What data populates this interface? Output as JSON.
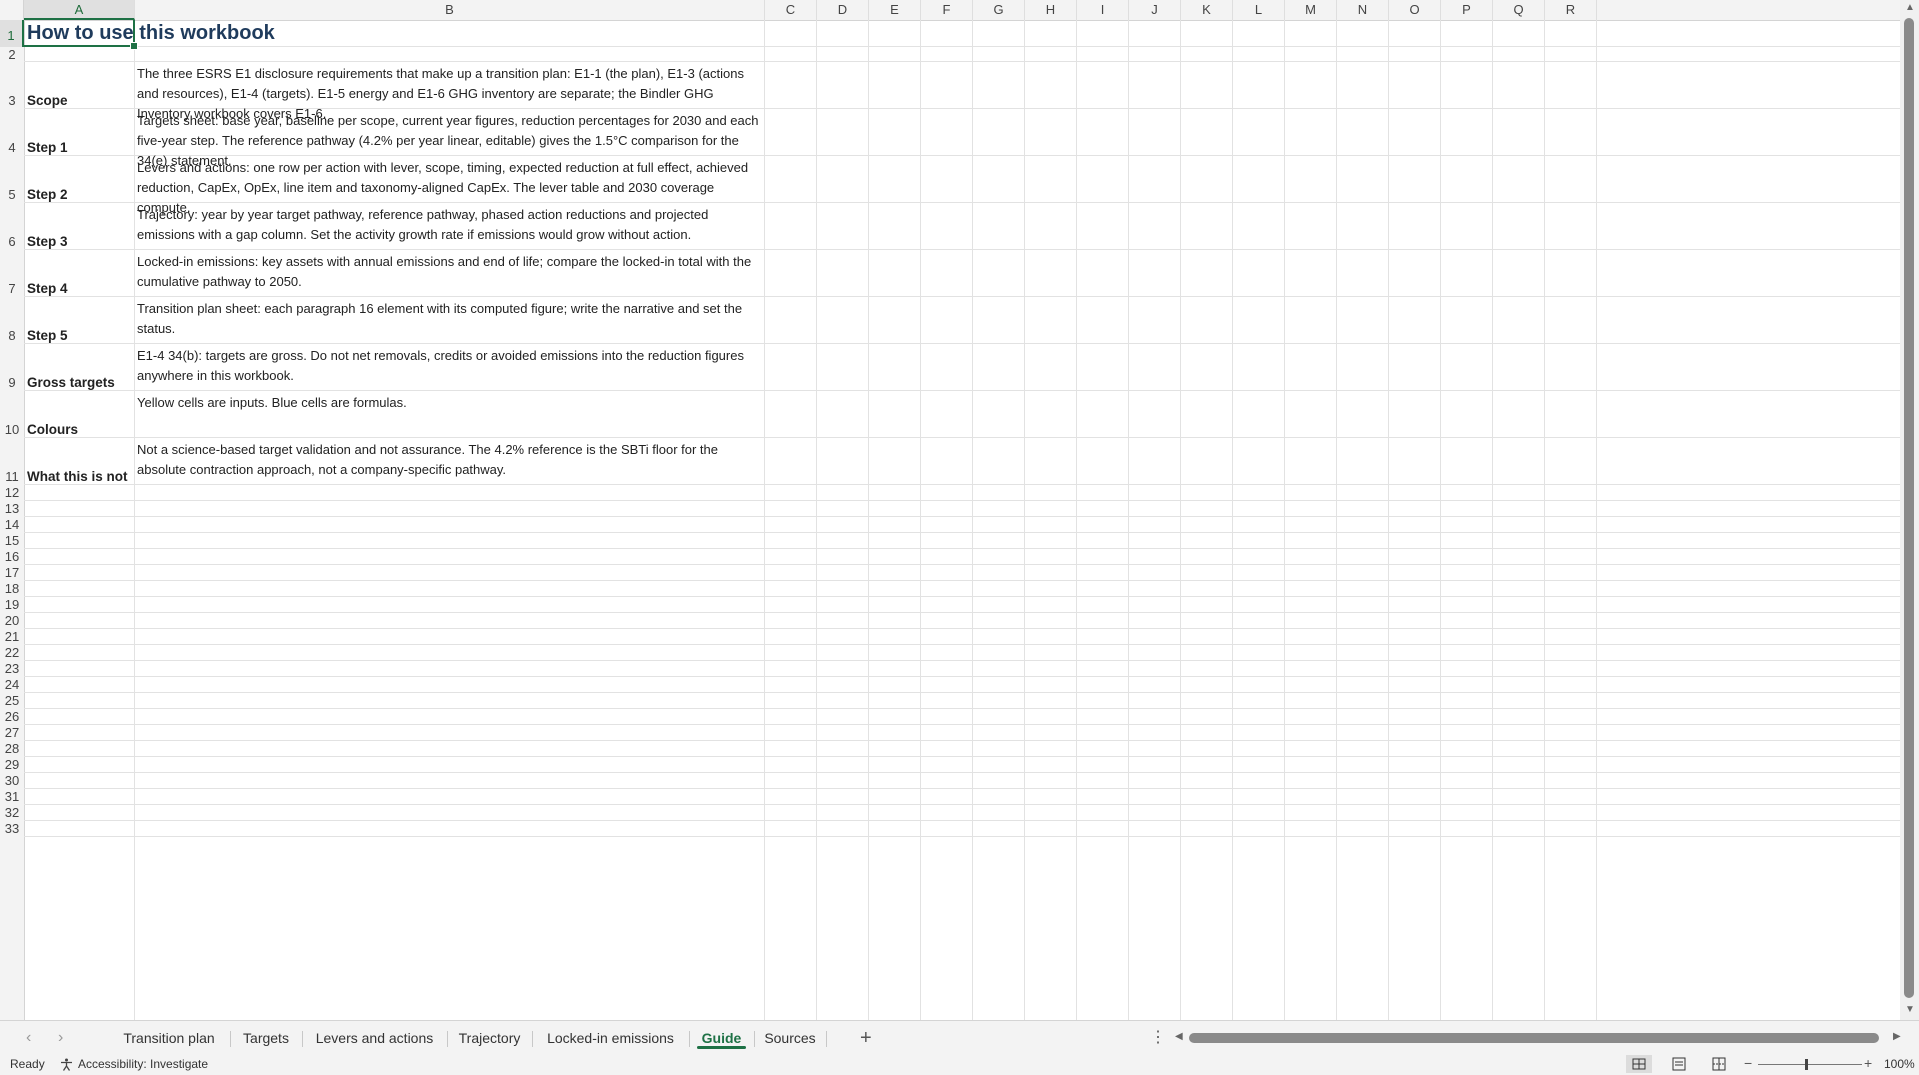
{
  "columns": [
    "A",
    "B",
    "C",
    "D",
    "E",
    "F",
    "G",
    "H",
    "I",
    "J",
    "K",
    "L",
    "M",
    "N",
    "O",
    "P",
    "Q",
    "R"
  ],
  "selected_cell": "A1",
  "rows": [
    "1",
    "2",
    "3",
    "4",
    "5",
    "6",
    "7",
    "8",
    "9",
    "10",
    "11",
    "12",
    "13",
    "14",
    "15",
    "16",
    "17",
    "18",
    "19",
    "20",
    "21",
    "22",
    "23",
    "24",
    "25",
    "26",
    "27",
    "28",
    "29",
    "30",
    "31",
    "32",
    "33"
  ],
  "sheet": {
    "title": "How to use this workbook",
    "sections": [
      {
        "label": "Scope",
        "text": "The three ESRS E1 disclosure requirements that make up a transition plan: E1-1 (the plan), E1-3 (actions and resources), E1-4 (targets). E1-5 energy and E1-6 GHG inventory are separate; the Bindler GHG Inventory workbook covers E1-6."
      },
      {
        "label": "Step 1",
        "text": "Targets sheet: base year, baseline per scope, current year figures, reduction percentages for 2030 and each five-year step. The reference pathway (4.2% per year linear, editable) gives the 1.5°C comparison for the 34(e) statement."
      },
      {
        "label": "Step 2",
        "text": "Levers and actions: one row per action with lever, scope, timing, expected reduction at full effect, achieved reduction, CapEx, OpEx, line item and taxonomy-aligned CapEx. The lever table and 2030 coverage compute."
      },
      {
        "label": "Step 3",
        "text": "Trajectory: year by year target pathway, reference pathway, phased action reductions and projected emissions with a gap column. Set the activity growth rate if emissions would grow without action."
      },
      {
        "label": "Step 4",
        "text": "Locked-in emissions: key assets with annual emissions and end of life; compare the locked-in total with the cumulative pathway to 2050."
      },
      {
        "label": "Step 5",
        "text": "Transition plan sheet: each paragraph 16 element with its computed figure; write the narrative and set the status."
      },
      {
        "label": "Gross targets",
        "text": "E1-4 34(b): targets are gross. Do not net removals, credits or avoided emissions into the reduction figures anywhere in this workbook."
      },
      {
        "label": "Colours",
        "text": "Yellow cells are inputs. Blue cells are formulas."
      },
      {
        "label": "What this is not",
        "text": "Not a science-based target validation and not assurance. The 4.2% reference is the SBTi floor for the absolute contraction approach, not a company-specific pathway."
      }
    ]
  },
  "tabs": [
    {
      "label": "Transition plan",
      "active": false
    },
    {
      "label": "Targets",
      "active": false
    },
    {
      "label": "Levers and actions",
      "active": false
    },
    {
      "label": "Trajectory",
      "active": false
    },
    {
      "label": "Locked-in emissions",
      "active": false
    },
    {
      "label": "Guide",
      "active": true
    },
    {
      "label": "Sources",
      "active": false
    }
  ],
  "status": {
    "ready": "Ready",
    "accessibility": "Accessibility: Investigate",
    "zoom": "100%"
  },
  "icons": {
    "prev_sheet": "chevron-left-icon",
    "next_sheet": "chevron-right-icon",
    "add_sheet": "plus-icon",
    "more": "vertical-ellipsis-icon",
    "accessibility": "accessibility-icon",
    "normal_view": "grid-view-icon",
    "page_layout": "page-layout-icon",
    "page_break": "page-break-icon"
  },
  "colors": {
    "accent": "#1e7145",
    "title": "#1f3b5c"
  }
}
